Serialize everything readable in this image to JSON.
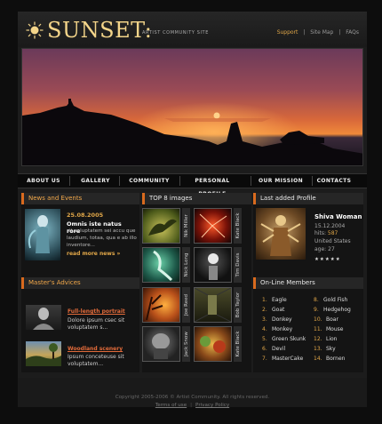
{
  "header": {
    "title": "SUNSET:",
    "subtitle": "ARTIST COMMUNITY SITE",
    "links": [
      "Support",
      "Site Map",
      "FAQs"
    ],
    "sep": "|"
  },
  "nav": [
    "ABOUT US",
    "GALLERY",
    "COMMUNITY",
    "PERSONAL PROFILE",
    "OUR MISSION",
    "CONTACTS"
  ],
  "news": {
    "heading": "News and Events",
    "date": "25.08.2005",
    "title": "Omnis iste natus rore",
    "body": "sit voluptatem sei accu que laudium, totaa, qua e ab illo inventore...",
    "more": "read more news »"
  },
  "advices": {
    "heading": "Master's Advices",
    "items": [
      {
        "title": "Full-length portrait",
        "body": "Dolore ipsum csec sit voluptatem s..."
      },
      {
        "title": "Woodland scenery",
        "body": "Ipsum conceteuse sit voluptatem..."
      }
    ]
  },
  "top8": {
    "heading": "TOP 8 images",
    "items": [
      {
        "label": "Nik Miller",
        "icon": "dragon-icon"
      },
      {
        "label": "Kate Black",
        "icon": "splash-icon"
      },
      {
        "label": "Nick Long",
        "icon": "mermaid-icon"
      },
      {
        "label": "Tim Davis",
        "icon": "figure-icon"
      },
      {
        "label": "Joe Reed",
        "icon": "sunset-tree-icon"
      },
      {
        "label": "Bob Taylor",
        "icon": "corridor-icon"
      },
      {
        "label": "Jack Snow",
        "icon": "monster-icon"
      },
      {
        "label": "Kate Black",
        "icon": "creatures-icon"
      }
    ]
  },
  "profile": {
    "heading": "Last added Profile",
    "name": "Shiva Woman",
    "date": "15.12.2004",
    "hits_label": "hits:",
    "hits_value": "587",
    "country": "United States",
    "age_label": "age:",
    "age_value": "27",
    "stars": "★★★★★"
  },
  "members": {
    "heading": "On-Line Members",
    "left": [
      {
        "n": "1.",
        "name": "Eagle"
      },
      {
        "n": "2.",
        "name": "Goat"
      },
      {
        "n": "3.",
        "name": "Donkey"
      },
      {
        "n": "4.",
        "name": "Monkey"
      },
      {
        "n": "5.",
        "name": "Green Skunk"
      },
      {
        "n": "6.",
        "name": "Devil"
      },
      {
        "n": "7.",
        "name": "MasterCake"
      }
    ],
    "right": [
      {
        "n": "8.",
        "name": "Gold Fish"
      },
      {
        "n": "9.",
        "name": "Hedgehog"
      },
      {
        "n": "10.",
        "name": "Boar"
      },
      {
        "n": "11.",
        "name": "Mouse"
      },
      {
        "n": "12.",
        "name": "Lion"
      },
      {
        "n": "13.",
        "name": "Sky"
      },
      {
        "n": "14.",
        "name": "Bornen"
      }
    ]
  },
  "footer": {
    "copyright": "Copyright 2005-2006 © Artist Community. All rights reserved.",
    "links": [
      "Terms of use",
      "Privacy Policy"
    ],
    "sep": "|"
  },
  "colors": {
    "accent": "#e0a648",
    "orange": "#d96a1e",
    "title": "#f4d58a"
  }
}
